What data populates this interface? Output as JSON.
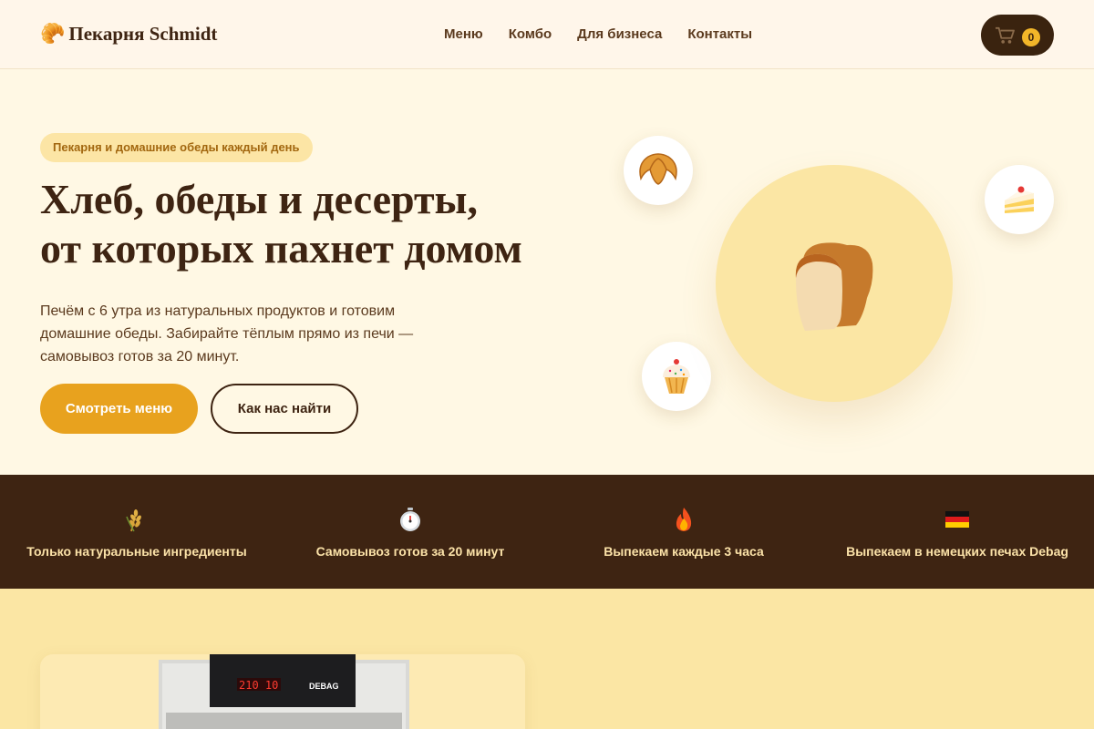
{
  "header": {
    "logo_icon": "croissant-icon",
    "brand": "Пекарня Schmidt",
    "nav": [
      "Меню",
      "Комбо",
      "Для бизнеса",
      "Контакты"
    ],
    "cart_count": "0"
  },
  "hero": {
    "badge": "Пекарня и домашние обеды каждый день",
    "title_line1": "Хлеб, обеды и десерты,",
    "title_line2": "от которых пахнет домом",
    "description": "Печём с 6 утра из натуральных продуктов и готовим домашние обеды. Забирайте тёплым прямо из печи — самовывоз готов за 20 минут.",
    "btn_primary": "Смотреть меню",
    "btn_secondary": "Как нас найти"
  },
  "features": [
    {
      "icon": "wheat-icon",
      "label": "Только натуральные ингредиенты"
    },
    {
      "icon": "stopwatch-icon",
      "label": "Самовывоз готов за 20 минут"
    },
    {
      "icon": "fire-icon",
      "label": "Выпекаем каждые 3 часа"
    },
    {
      "icon": "germany-flag-icon",
      "label": "Выпекаем в немецких печах Debag"
    }
  ],
  "oven": {
    "display": "210 10",
    "brand": "DEBAG"
  },
  "colors": {
    "accent": "#e8a21e",
    "dark": "#3e2412",
    "hero_bg": "#fff8e4",
    "circle": "#fbe6a4"
  }
}
